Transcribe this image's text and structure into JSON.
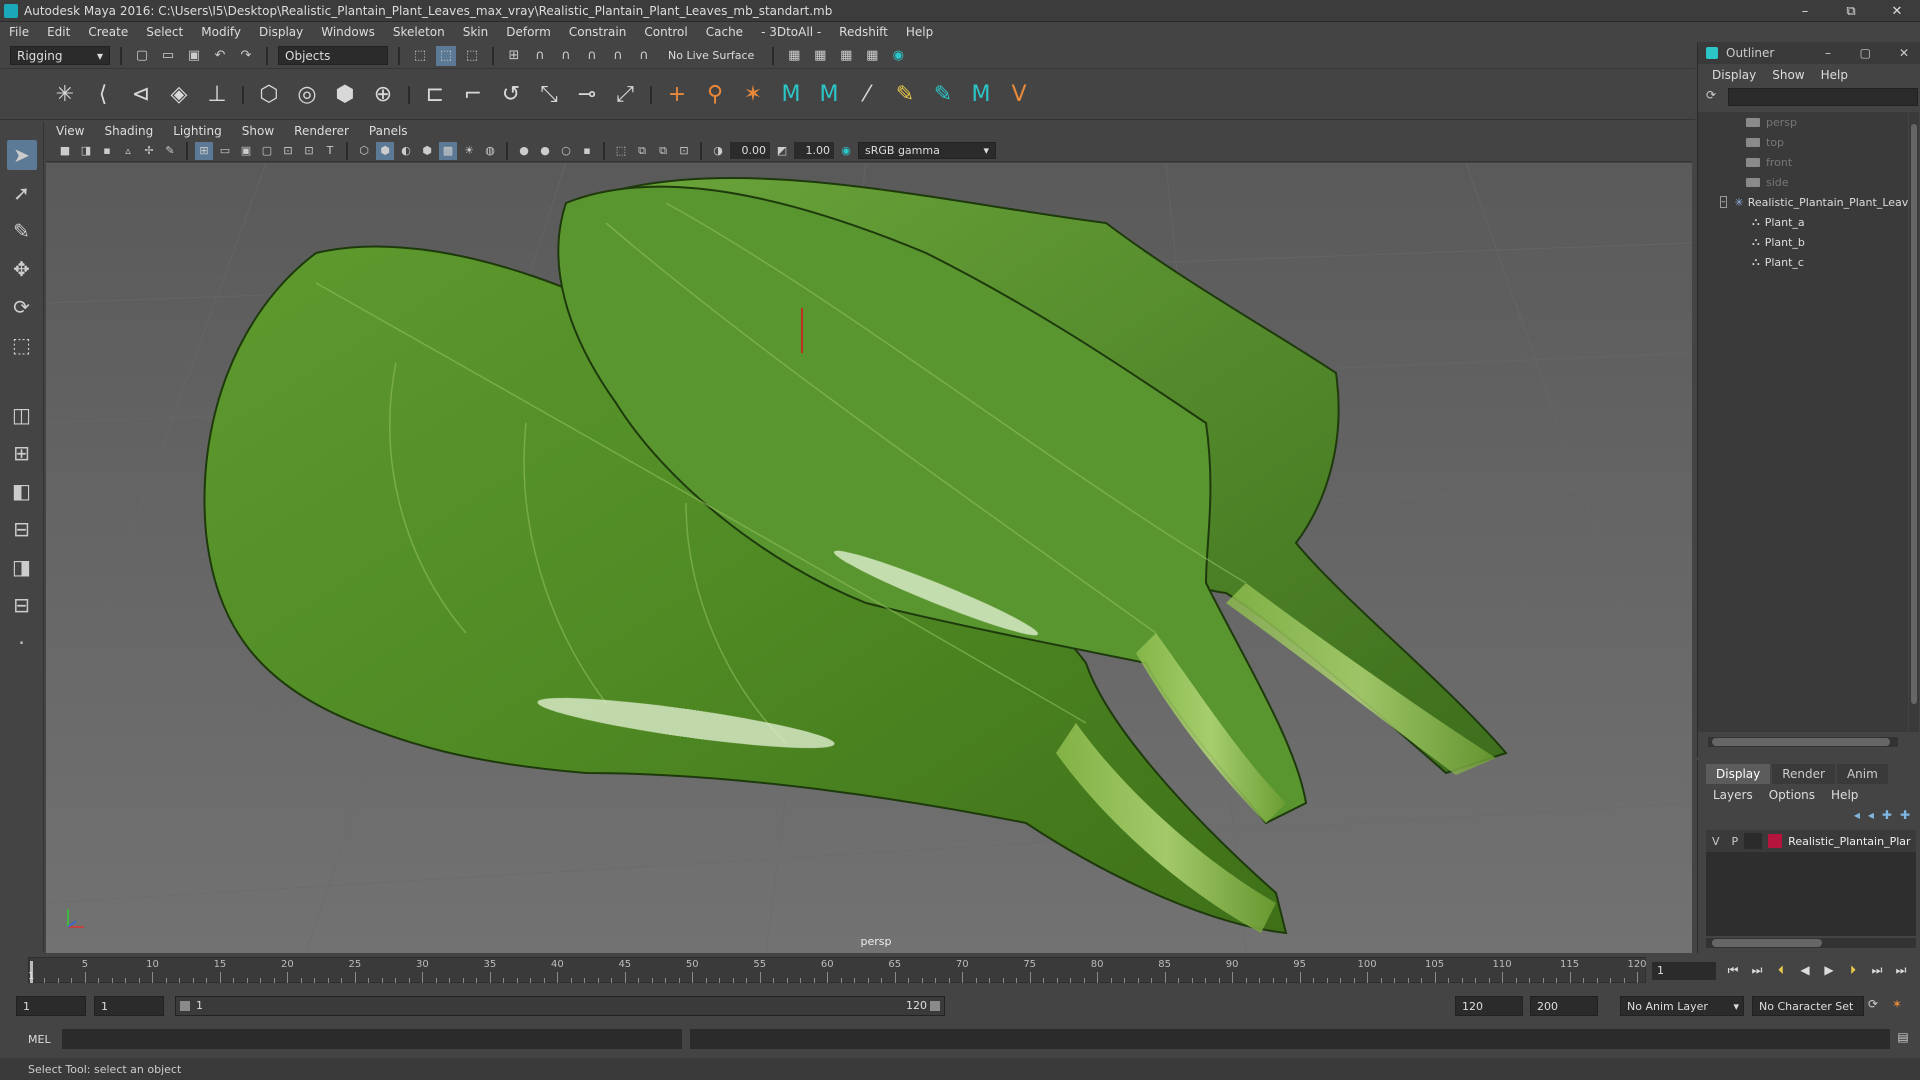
{
  "window": {
    "title": "Autodesk Maya 2016: C:\\Users\\I5\\Desktop\\Realistic_Plantain_Plant_Leaves_max_vray\\Realistic_Plantain_Plant_Leaves_mb_standart.mb",
    "minimize": "–",
    "restore": "⧉",
    "close": "✕"
  },
  "menubar": [
    "File",
    "Edit",
    "Create",
    "Select",
    "Modify",
    "Display",
    "Windows",
    "Skeleton",
    "Skin",
    "Deform",
    "Constrain",
    "Control",
    "Cache",
    "- 3DtoAll -",
    "Redshift",
    "Help"
  ],
  "status": {
    "menuset": "Rigging",
    "select_mode": "Objects",
    "live_surface": "No Live Surface"
  },
  "viewport": {
    "menus": [
      "View",
      "Shading",
      "Lighting",
      "Show",
      "Renderer",
      "Panels"
    ],
    "exposure": "0.00",
    "gamma": "1.00",
    "color_space": "sRGB gamma",
    "camera_label": "persp"
  },
  "outliner": {
    "title": "Outliner",
    "menus": [
      "Display",
      "Show",
      "Help"
    ],
    "items": [
      {
        "label": "persp",
        "kind": "camera"
      },
      {
        "label": "top",
        "kind": "camera"
      },
      {
        "label": "front",
        "kind": "camera"
      },
      {
        "label": "side",
        "kind": "camera"
      },
      {
        "label": "Realistic_Plantain_Plant_Leav",
        "kind": "group"
      },
      {
        "label": "Plant_a",
        "kind": "mesh"
      },
      {
        "label": "Plant_b",
        "kind": "mesh"
      },
      {
        "label": "Plant_c",
        "kind": "mesh"
      }
    ]
  },
  "layers": {
    "tabs": [
      "Display",
      "Render",
      "Anim"
    ],
    "menus": [
      "Layers",
      "Options",
      "Help"
    ],
    "row": {
      "v": "V",
      "p": "P",
      "name": "Realistic_Plantain_Plar",
      "color": "#b5143c"
    }
  },
  "timeline": {
    "ticks": [
      "5",
      "10",
      "15",
      "20",
      "25",
      "30",
      "35",
      "40",
      "45",
      "50",
      "55",
      "60",
      "65",
      "70",
      "75",
      "80",
      "85",
      "90",
      "95",
      "100",
      "105",
      "110",
      "115",
      "120"
    ],
    "start_label": "1",
    "current_frame": "1"
  },
  "range": {
    "start": "1",
    "playback_start": "1",
    "range_start": "1",
    "range_end": "120",
    "playback_end": "120",
    "end": "200",
    "anim_layer": "No Anim Layer",
    "character_set": "No Character Set"
  },
  "cmdline": {
    "lang": "MEL"
  },
  "helpline": {
    "text": "Select Tool: select an object"
  },
  "colors": {
    "leaf": "#5a8f2a",
    "accent": "#2cc6c8"
  }
}
